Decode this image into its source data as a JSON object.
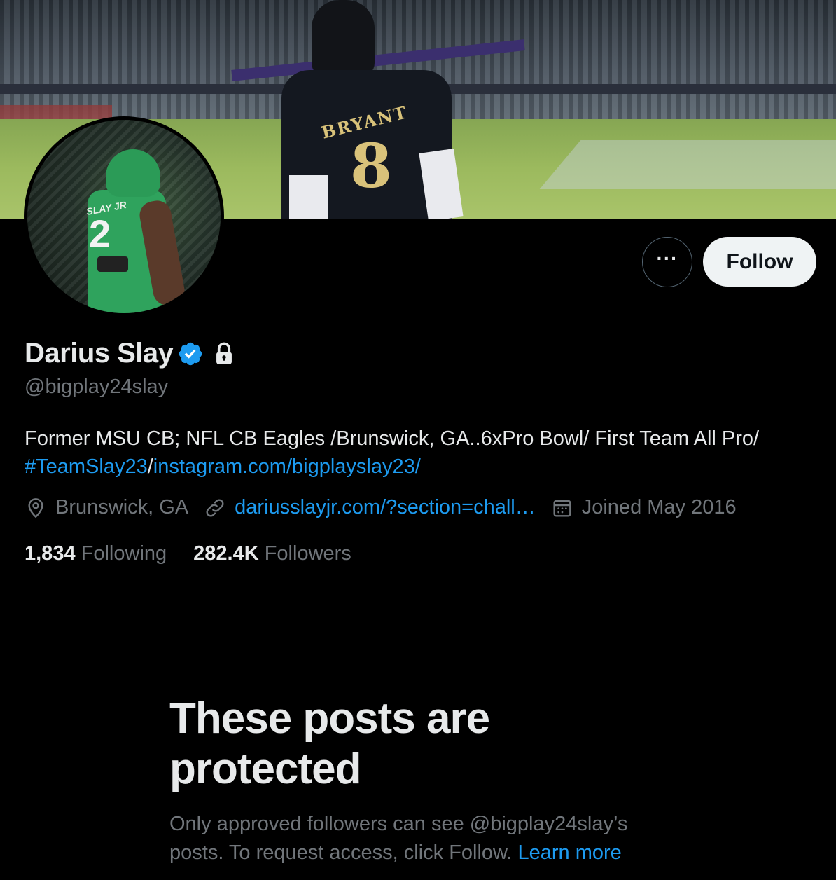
{
  "profile": {
    "display_name": "Darius Slay",
    "handle": "@bigplay24slay",
    "bio_text": "Former MSU CB; NFL CB Eagles /Brunswick, GA..6xPro Bowl/ First Team All Pro/",
    "bio_hashtag": "#TeamSlay23",
    "bio_sep": "/",
    "bio_link": "instagram.com/bigplayslay23/",
    "location": "Brunswick, GA",
    "website": "dariusslayjr.com/?section=chall…",
    "joined": "Joined May 2016",
    "avatar_jersey_name": "SLAY JR",
    "avatar_jersey_number": "2"
  },
  "banner": {
    "jersey_name": "BRYANT",
    "jersey_number": "8"
  },
  "actions": {
    "more_label": "···",
    "follow_label": "Follow"
  },
  "stats": {
    "following_count": "1,834",
    "following_label": "Following",
    "followers_count": "282.4K",
    "followers_label": "Followers"
  },
  "protected": {
    "title": "These posts are protected",
    "message": "Only approved followers can see @bigplay24slay’s posts. To request access, click Follow.",
    "learn_more": "Learn more"
  },
  "colors": {
    "accent": "#1d9bf0",
    "muted": "#71767b",
    "text": "#e7e9ea",
    "background": "#000000",
    "follow_bg": "#eff3f4"
  },
  "icons": {
    "verified": "verified-badge-icon",
    "lock": "lock-icon",
    "location": "location-pin-icon",
    "link": "link-icon",
    "calendar": "calendar-icon"
  }
}
